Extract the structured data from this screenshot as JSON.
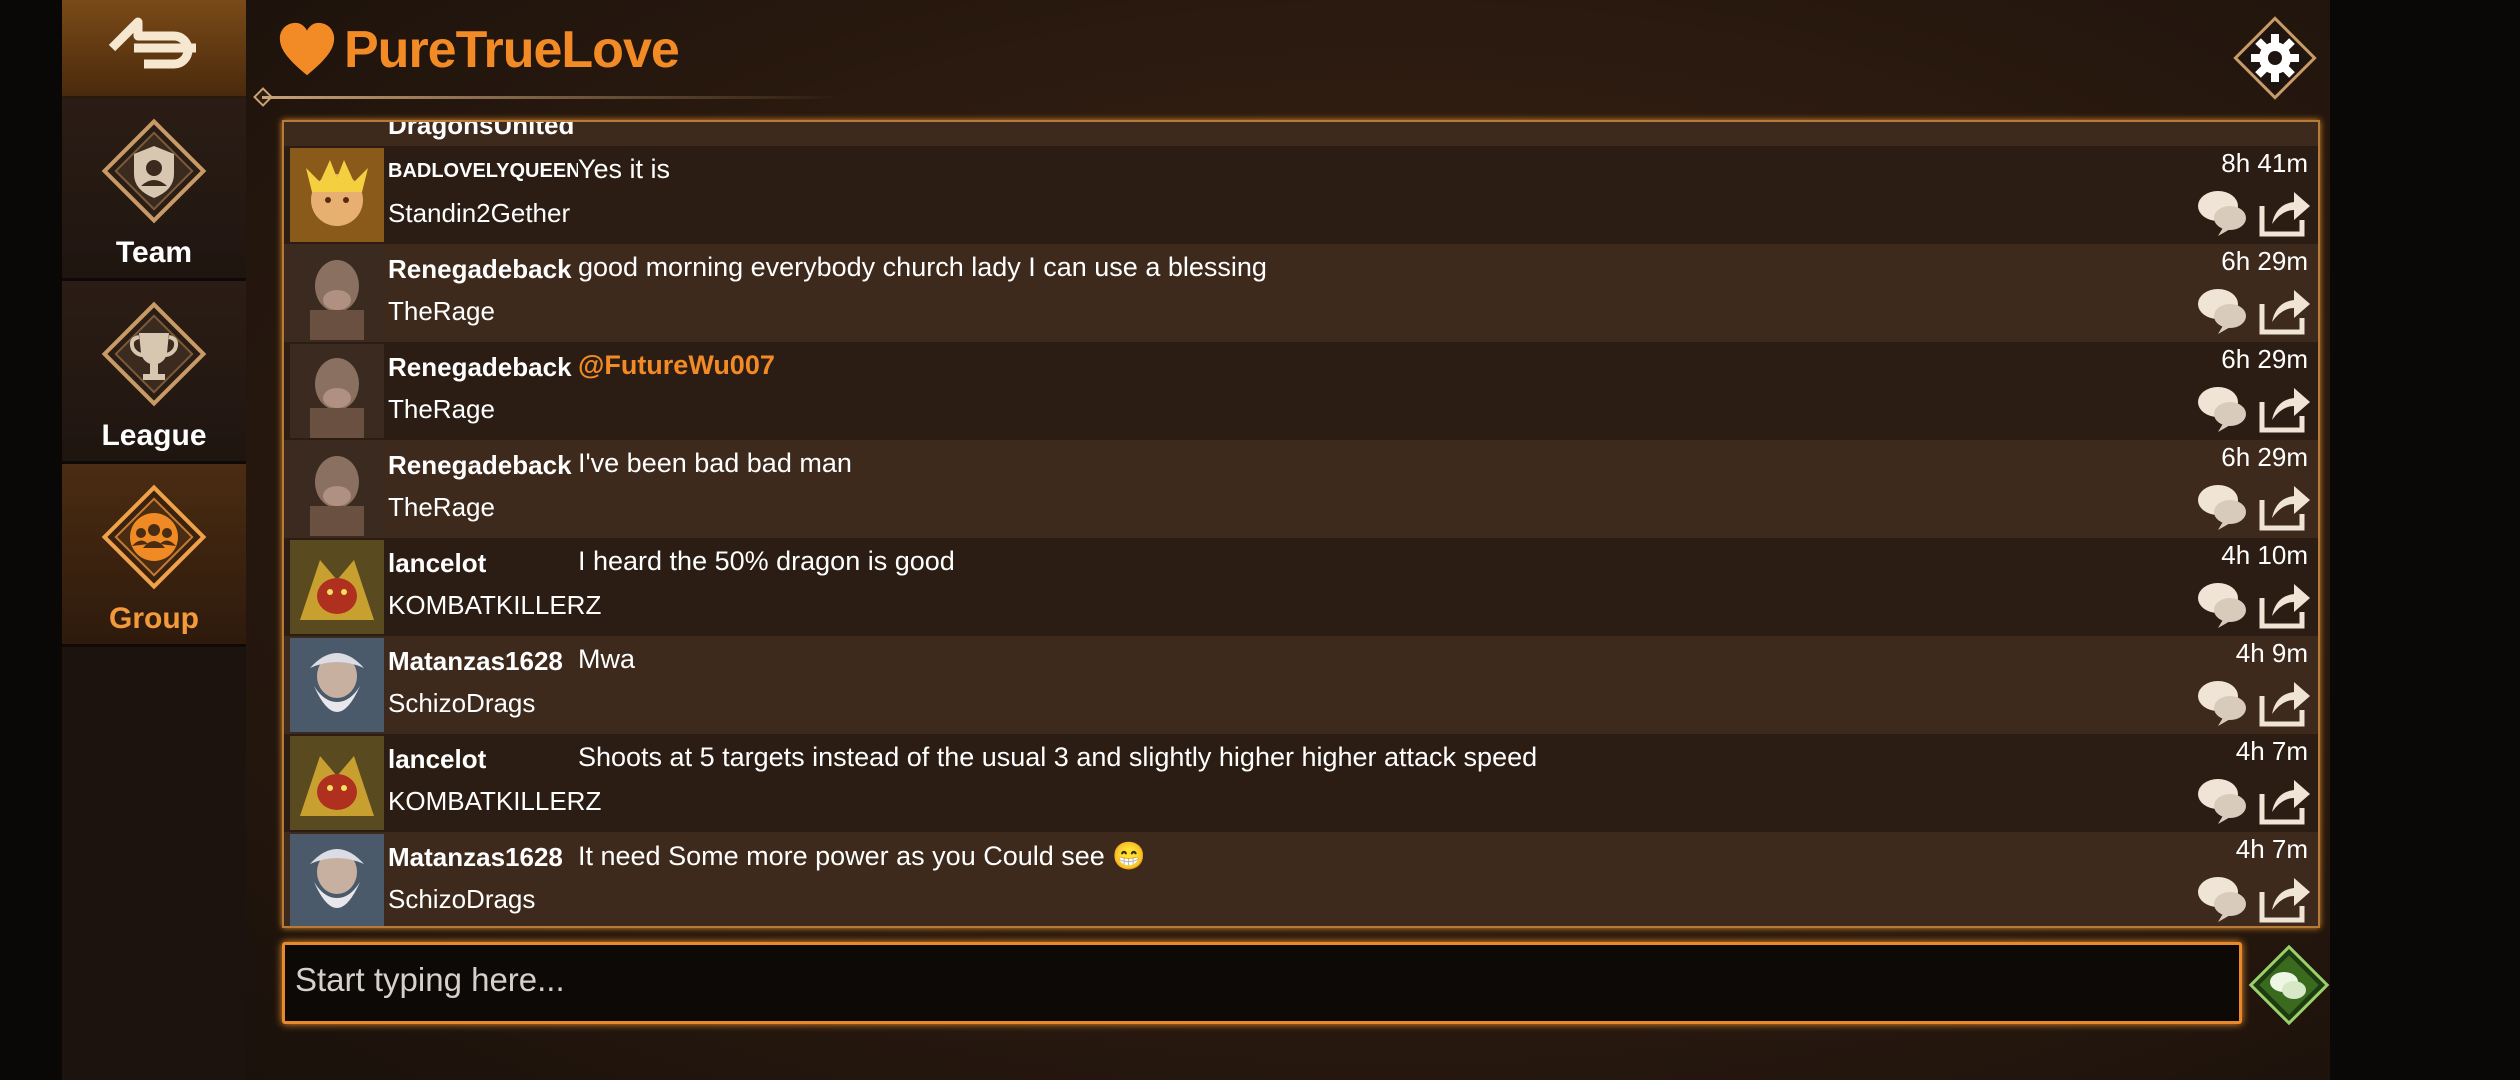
{
  "app": {
    "title": "PureTrueLove"
  },
  "sidebar": {
    "back_icon": "back-arrow-icon",
    "items": [
      {
        "label": "Team",
        "icon": "shield-icon"
      },
      {
        "label": "League",
        "icon": "trophy-icon"
      },
      {
        "label": "Group",
        "icon": "group-icon",
        "active": true
      }
    ]
  },
  "chat": {
    "partial_top_user": "DragonsUnited",
    "messages": [
      {
        "user": "BADLOVELYQUEEN",
        "team": "Standin2Gether",
        "text": "Yes it is",
        "time": "8h 41m",
        "avatar": "queen-avatar"
      },
      {
        "user": "Renegadeback",
        "team": "TheRage",
        "text": "good morning everybody church lady I can use a blessing",
        "time": "6h 29m",
        "avatar": "ape-avatar"
      },
      {
        "user": "Renegadeback",
        "team": "TheRage",
        "text": "@FutureWu007",
        "time": "6h 29m",
        "avatar": "ape-avatar",
        "mention": true
      },
      {
        "user": "Renegadeback",
        "team": "TheRage",
        "text": "I've been bad bad man",
        "time": "6h 29m",
        "avatar": "ape-avatar"
      },
      {
        "user": "lancelot",
        "team": "KOMBATKILLERZ",
        "text": "I heard the 50% dragon is good",
        "time": "4h 10m",
        "avatar": "dragon-avatar"
      },
      {
        "user": "Matanzas1628",
        "team": "SchizoDrags",
        "text": "Mwa",
        "time": "4h 9m",
        "avatar": "wizard-avatar"
      },
      {
        "user": "lancelot",
        "team": "KOMBATKILLERZ",
        "text": "Shoots at 5 targets instead of the usual 3 and slightly higher higher attack speed",
        "time": "4h 7m",
        "avatar": "dragon-avatar"
      },
      {
        "user": "Matanzas1628",
        "team": "SchizoDrags",
        "text": "It need Some more power as you Could see 😁",
        "time": "4h 7m",
        "avatar": "wizard-avatar"
      }
    ]
  },
  "input": {
    "placeholder": "Start typing here..."
  },
  "colors": {
    "accent": "#f28a26",
    "panel_dark": "#2b1d14",
    "panel_light": "#3e2a1c",
    "text": "#ffffff"
  }
}
